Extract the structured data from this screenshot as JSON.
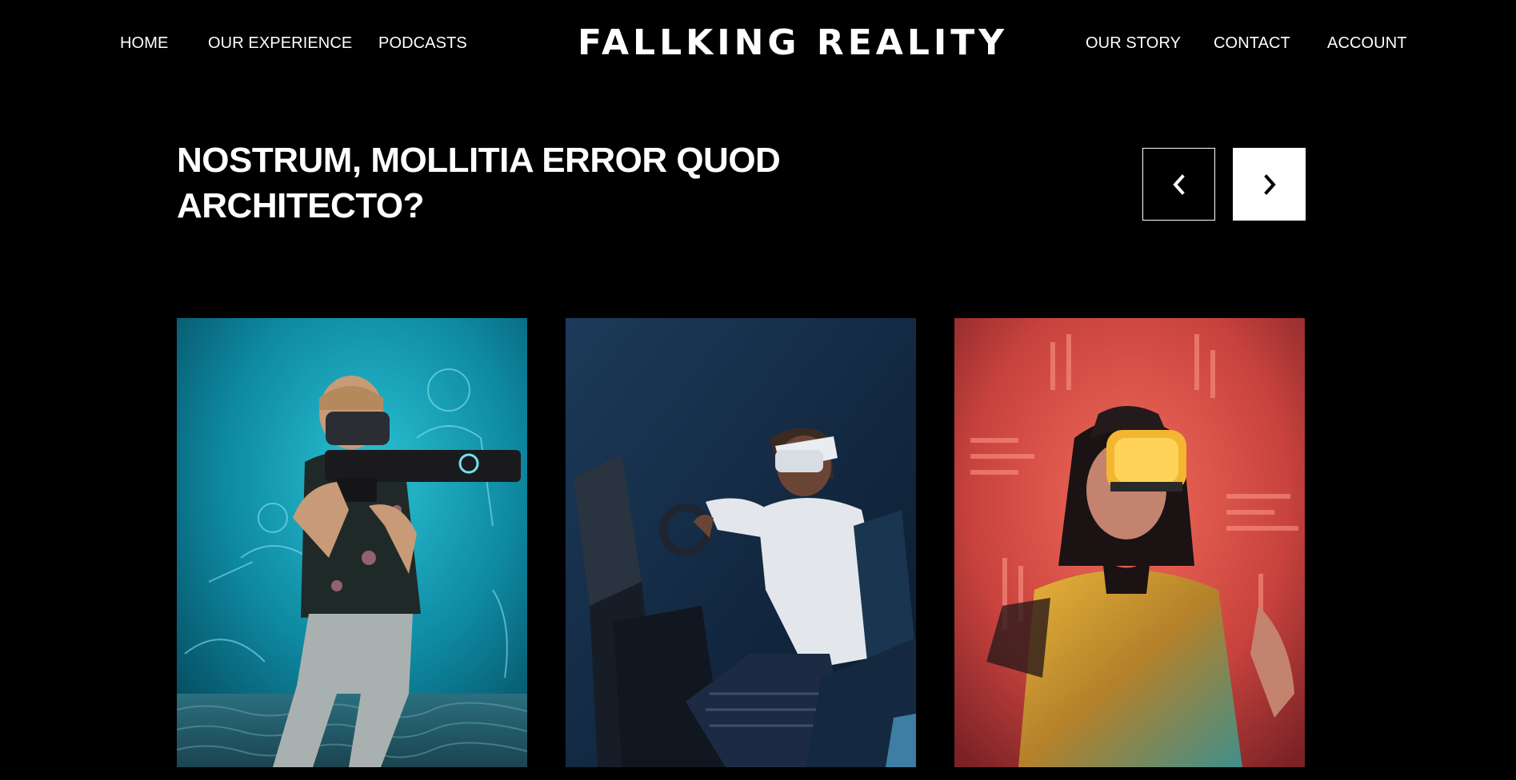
{
  "nav": {
    "left": [
      "HOME",
      "OUR EXPERIENCE",
      "PODCASTS"
    ],
    "right": [
      "OUR STORY",
      "CONTACT",
      "ACCOUNT"
    ]
  },
  "brand": {
    "logo_text": "FALLKING REALITY"
  },
  "slider": {
    "title": "NOSTRUM, MOLLITIA ERROR QUOD ARCHITECTO?",
    "prev_icon": "chevron-left-icon",
    "next_icon": "chevron-right-icon"
  },
  "cards": [
    {
      "image": "vr-player-with-blaster-photo",
      "accent": "#18a6bd"
    },
    {
      "image": "vr-racing-simulator-photo",
      "accent": "#1e3a5c"
    },
    {
      "image": "vr-headset-neon-photo",
      "accent": "#e2594a"
    }
  ]
}
